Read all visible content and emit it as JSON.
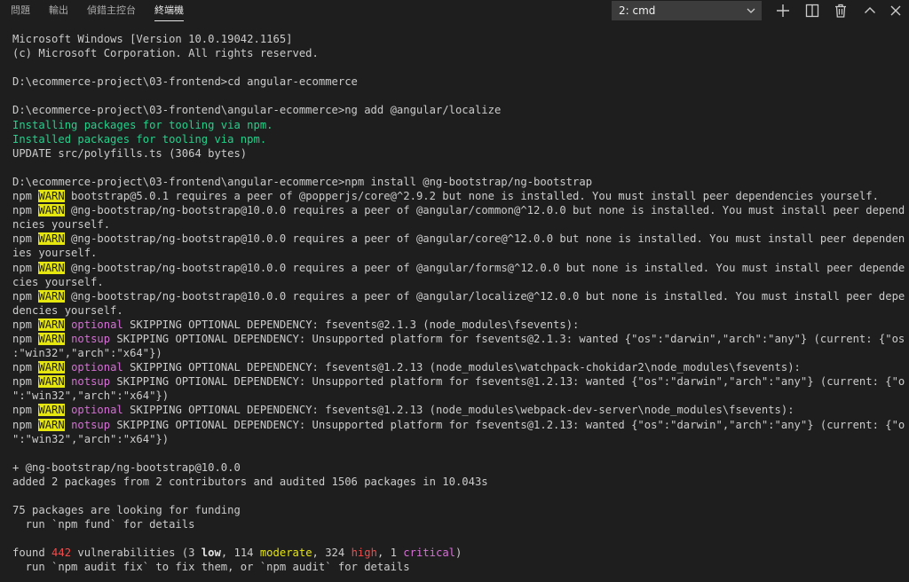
{
  "panel": {
    "tabs": [
      {
        "label": "問題"
      },
      {
        "label": "輸出"
      },
      {
        "label": "偵錯主控台"
      },
      {
        "label": "終端機",
        "active": true
      }
    ],
    "terminal_select": "2: cmd",
    "icons": [
      "plus-icon",
      "split-terminal-icon",
      "trash-icon",
      "chevron-up-icon",
      "close-icon"
    ]
  },
  "colors": {
    "background": "#1e1e1e",
    "text": "#cccccc",
    "green": "#23d18b",
    "magenta": "#d670d6",
    "yellow": "#e5e510",
    "red": "#f14c4c"
  },
  "terminal": {
    "lines": [
      [
        {
          "t": "Microsoft Windows [Version 10.0.19042.1165]"
        }
      ],
      [
        {
          "t": "(c) Microsoft Corporation. All rights reserved."
        }
      ],
      [
        {
          "t": ""
        }
      ],
      [
        {
          "t": "D:\\ecommerce-project\\03-frontend>cd angular-ecommerce"
        }
      ],
      [
        {
          "t": ""
        }
      ],
      [
        {
          "t": "D:\\ecommerce-project\\03-frontend\\angular-ecommerce>ng add @angular/localize"
        }
      ],
      [
        {
          "t": "Installing packages for tooling via npm.",
          "c": "green"
        }
      ],
      [
        {
          "t": "Installed packages for tooling via npm.",
          "c": "green"
        }
      ],
      [
        {
          "t": "UPDATE src/polyfills.ts (3064 bytes)"
        }
      ],
      [
        {
          "t": ""
        }
      ],
      [
        {
          "t": "D:\\ecommerce-project\\03-frontend\\angular-ecommerce>npm install @ng-bootstrap/ng-bootstrap"
        }
      ],
      [
        {
          "t": "npm "
        },
        {
          "t": "WARN",
          "c": "warn"
        },
        {
          "t": " bootstrap@5.0.1 requires a peer of @popperjs/core@^2.9.2 but none is installed. You must install peer dependencies yourself."
        }
      ],
      [
        {
          "t": "npm "
        },
        {
          "t": "WARN",
          "c": "warn"
        },
        {
          "t": " @ng-bootstrap/ng-bootstrap@10.0.0 requires a peer of @angular/common@^12.0.0 but none is installed. You must install peer depende"
        }
      ],
      [
        {
          "t": "ncies yourself."
        }
      ],
      [
        {
          "t": "npm "
        },
        {
          "t": "WARN",
          "c": "warn"
        },
        {
          "t": " @ng-bootstrap/ng-bootstrap@10.0.0 requires a peer of @angular/core@^12.0.0 but none is installed. You must install peer dependenc"
        }
      ],
      [
        {
          "t": "ies yourself."
        }
      ],
      [
        {
          "t": "npm "
        },
        {
          "t": "WARN",
          "c": "warn"
        },
        {
          "t": " @ng-bootstrap/ng-bootstrap@10.0.0 requires a peer of @angular/forms@^12.0.0 but none is installed. You must install peer dependen"
        }
      ],
      [
        {
          "t": "cies yourself."
        }
      ],
      [
        {
          "t": "npm "
        },
        {
          "t": "WARN",
          "c": "warn"
        },
        {
          "t": " @ng-bootstrap/ng-bootstrap@10.0.0 requires a peer of @angular/localize@^12.0.0 but none is installed. You must install peer depen"
        }
      ],
      [
        {
          "t": "dencies yourself."
        }
      ],
      [
        {
          "t": "npm "
        },
        {
          "t": "WARN",
          "c": "warn"
        },
        {
          "t": " "
        },
        {
          "t": "optional",
          "c": "magenta"
        },
        {
          "t": " SKIPPING OPTIONAL DEPENDENCY: fsevents@2.1.3 (node_modules\\fsevents):"
        }
      ],
      [
        {
          "t": "npm "
        },
        {
          "t": "WARN",
          "c": "warn"
        },
        {
          "t": " "
        },
        {
          "t": "notsup",
          "c": "magenta"
        },
        {
          "t": " SKIPPING OPTIONAL DEPENDENCY: Unsupported platform for fsevents@2.1.3: wanted {\"os\":\"darwin\",\"arch\":\"any\"} (current: {\"os\""
        }
      ],
      [
        {
          "t": ":\"win32\",\"arch\":\"x64\"})"
        }
      ],
      [
        {
          "t": "npm "
        },
        {
          "t": "WARN",
          "c": "warn"
        },
        {
          "t": " "
        },
        {
          "t": "optional",
          "c": "magenta"
        },
        {
          "t": " SKIPPING OPTIONAL DEPENDENCY: fsevents@1.2.13 (node_modules\\watchpack-chokidar2\\node_modules\\fsevents):"
        }
      ],
      [
        {
          "t": "npm "
        },
        {
          "t": "WARN",
          "c": "warn"
        },
        {
          "t": " "
        },
        {
          "t": "notsup",
          "c": "magenta"
        },
        {
          "t": " SKIPPING OPTIONAL DEPENDENCY: Unsupported platform for fsevents@1.2.13: wanted {\"os\":\"darwin\",\"arch\":\"any\"} (current: {\"os"
        }
      ],
      [
        {
          "t": "\":\"win32\",\"arch\":\"x64\"})"
        }
      ],
      [
        {
          "t": "npm "
        },
        {
          "t": "WARN",
          "c": "warn"
        },
        {
          "t": " "
        },
        {
          "t": "optional",
          "c": "magenta"
        },
        {
          "t": " SKIPPING OPTIONAL DEPENDENCY: fsevents@1.2.13 (node_modules\\webpack-dev-server\\node_modules\\fsevents):"
        }
      ],
      [
        {
          "t": "npm "
        },
        {
          "t": "WARN",
          "c": "warn"
        },
        {
          "t": " "
        },
        {
          "t": "notsup",
          "c": "magenta"
        },
        {
          "t": " SKIPPING OPTIONAL DEPENDENCY: Unsupported platform for fsevents@1.2.13: wanted {\"os\":\"darwin\",\"arch\":\"any\"} (current: {\"os"
        }
      ],
      [
        {
          "t": "\":\"win32\",\"arch\":\"x64\"})"
        }
      ],
      [
        {
          "t": ""
        }
      ],
      [
        {
          "t": "+ @ng-bootstrap/ng-bootstrap@10.0.0"
        }
      ],
      [
        {
          "t": "added 2 packages from 2 contributors and audited 1506 packages in 10.043s"
        }
      ],
      [
        {
          "t": ""
        }
      ],
      [
        {
          "t": "75 packages are looking for funding"
        }
      ],
      [
        {
          "t": "  run `npm fund` for details"
        }
      ],
      [
        {
          "t": ""
        }
      ],
      [
        {
          "t": "found "
        },
        {
          "t": "442",
          "c": "red"
        },
        {
          "t": " vulnerabilities (3 "
        },
        {
          "t": "low",
          "c": "bold"
        },
        {
          "t": ", 114 "
        },
        {
          "t": "moderate",
          "c": "yellow"
        },
        {
          "t": ", 324 "
        },
        {
          "t": "high",
          "c": "red"
        },
        {
          "t": ", 1 "
        },
        {
          "t": "critical",
          "c": "magenta"
        },
        {
          "t": ")"
        }
      ],
      [
        {
          "t": "  run `npm audit fix` to fix them, or `npm audit` for details"
        }
      ]
    ]
  }
}
